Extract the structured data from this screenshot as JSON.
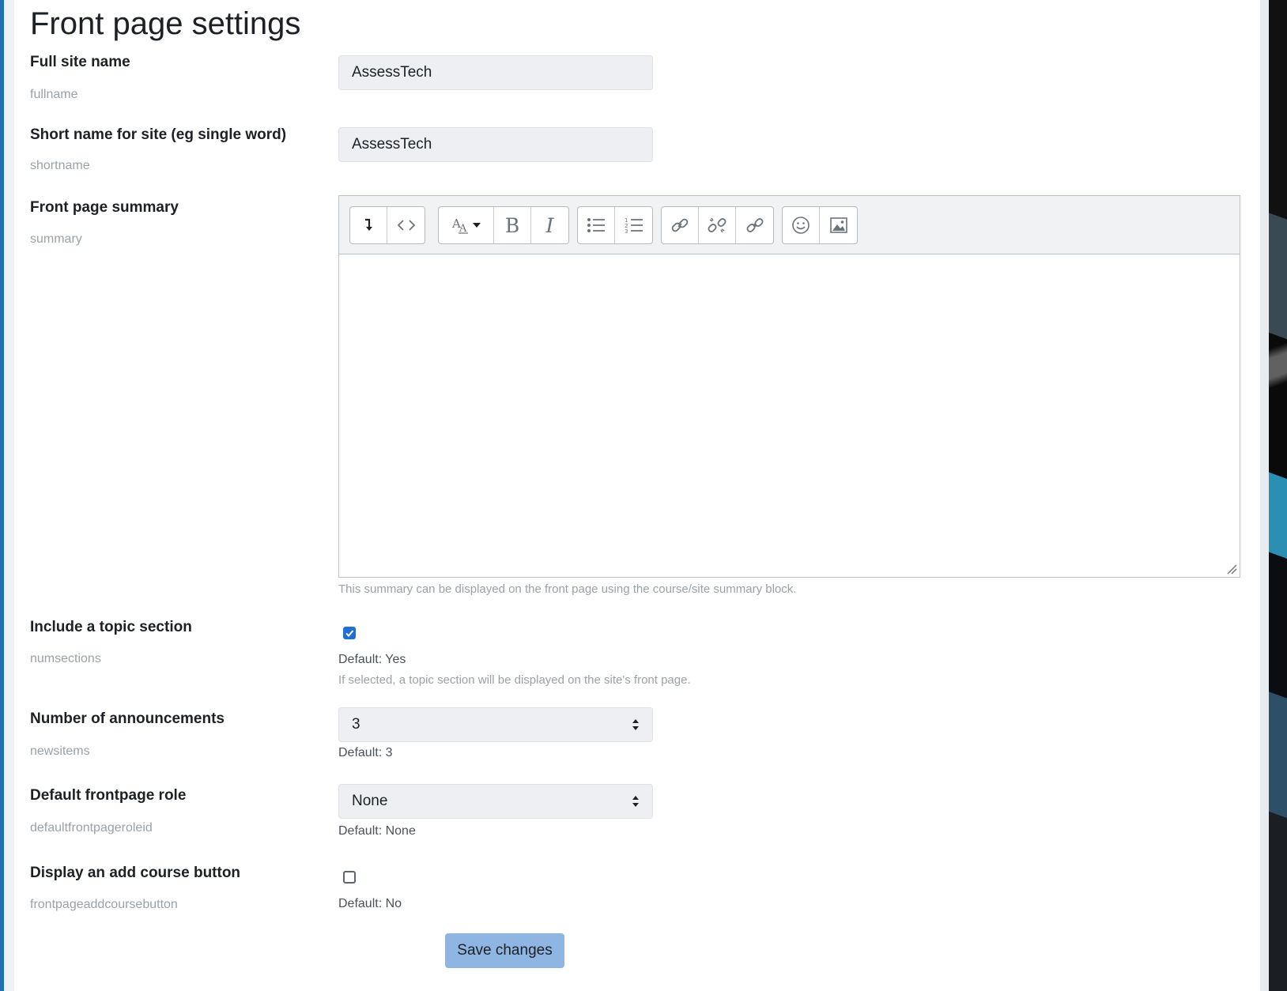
{
  "page_title": "Front page settings",
  "fields": {
    "fullname": {
      "label": "Full site name",
      "name": "fullname",
      "value": "AssessTech"
    },
    "shortname": {
      "label": "Short name for site (eg single word)",
      "name": "shortname",
      "value": "AssessTech"
    },
    "summary": {
      "label": "Front page summary",
      "name": "summary",
      "help": "This summary can be displayed on the front page using the course/site summary block.",
      "toolbar": [
        "expand-toolbar-icon",
        "html-source-icon",
        "font-style-icon",
        "bold-icon",
        "italic-icon",
        "unordered-list-icon",
        "ordered-list-icon",
        "link-icon",
        "unlink-icon",
        "manage-files-icon",
        "emoji-icon",
        "image-icon"
      ]
    },
    "numsections": {
      "label": "Include a topic section",
      "name": "numsections",
      "checked": true,
      "default": "Default: Yes",
      "help": "If selected, a topic section will be displayed on the site's front page."
    },
    "newsitems": {
      "label": "Number of announcements",
      "name": "newsitems",
      "value": "3",
      "default": "Default: 3"
    },
    "defaultfrontpageroleid": {
      "label": "Default frontpage role",
      "name": "defaultfrontpageroleid",
      "value": "None",
      "default": "Default: None"
    },
    "frontpageaddcoursebutton": {
      "label": "Display an add course button",
      "name": "frontpageaddcoursebutton",
      "checked": false,
      "default": "Default: No"
    }
  },
  "save_button": "Save changes",
  "colors": {
    "accent": "#1f6fd4",
    "save_button_bg": "#8fb5e2",
    "input_bg": "#edeff2",
    "muted_text": "#9aa1a7"
  }
}
